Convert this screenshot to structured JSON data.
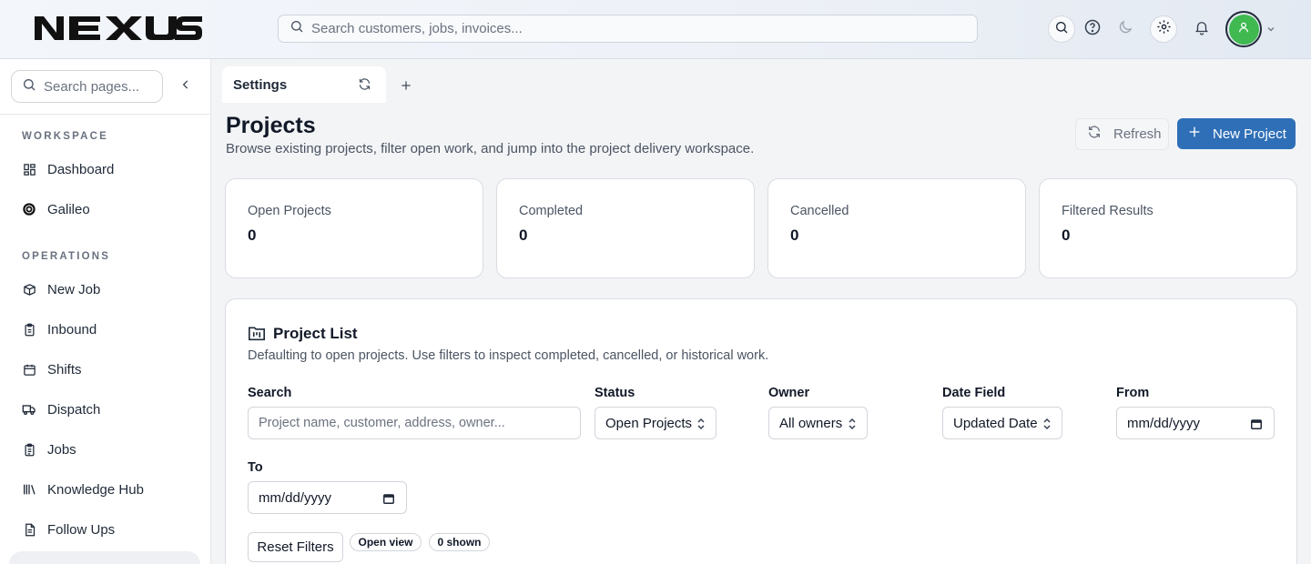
{
  "brand": {
    "logo_text": "NEXUS"
  },
  "header": {
    "search_placeholder": "Search customers, jobs, invoices...",
    "icons": [
      "search-icon",
      "help-icon",
      "moon-icon",
      "gear-icon",
      "bell-icon",
      "user-icon",
      "chevron-down-icon"
    ],
    "avatar_color": "#3fb950"
  },
  "sidebar": {
    "search_placeholder": "Search pages...",
    "sections": [
      {
        "title": "WORKSPACE",
        "items": [
          {
            "label": "Dashboard",
            "icon": "dashboard-icon"
          },
          {
            "label": "Galileo",
            "icon": "galileo-icon"
          }
        ]
      },
      {
        "title": "OPERATIONS",
        "items": [
          {
            "label": "New Job",
            "icon": "box-icon"
          },
          {
            "label": "Inbound",
            "icon": "clipboard-icon"
          },
          {
            "label": "Shifts",
            "icon": "calendar-icon"
          },
          {
            "label": "Dispatch",
            "icon": "truck-icon"
          },
          {
            "label": "Jobs",
            "icon": "clipboard-list-icon"
          },
          {
            "label": "Knowledge Hub",
            "icon": "library-icon"
          },
          {
            "label": "Follow Ups",
            "icon": "document-icon"
          }
        ]
      }
    ]
  },
  "tabs": {
    "active": "Settings"
  },
  "page": {
    "title": "Projects",
    "subtitle": "Browse existing projects, filter open work, and jump into the project delivery workspace.",
    "refresh_label": "Refresh",
    "new_label": "New Project",
    "accent_color": "#2f6fb7"
  },
  "stats": [
    {
      "label": "Open Projects",
      "value": "0"
    },
    {
      "label": "Completed",
      "value": "0"
    },
    {
      "label": "Cancelled",
      "value": "0"
    },
    {
      "label": "Filtered Results",
      "value": "0"
    }
  ],
  "list": {
    "title": "Project List",
    "description": "Defaulting to open projects. Use filters to inspect completed, cancelled, or historical work.",
    "filters": {
      "search_label": "Search",
      "search_placeholder": "Project name, customer, address, owner...",
      "status_label": "Status",
      "status_value": "Open Projects",
      "owner_label": "Owner",
      "owner_value": "All owners",
      "date_field_label": "Date Field",
      "date_field_value": "Updated Date",
      "from_label": "From",
      "from_placeholder": "mm/dd/yyyy",
      "to_label": "To",
      "to_placeholder": "mm/dd/yyyy"
    },
    "reset_label": "Reset Filters",
    "view_pill": "Open view",
    "shown_pill": "0 shown"
  }
}
